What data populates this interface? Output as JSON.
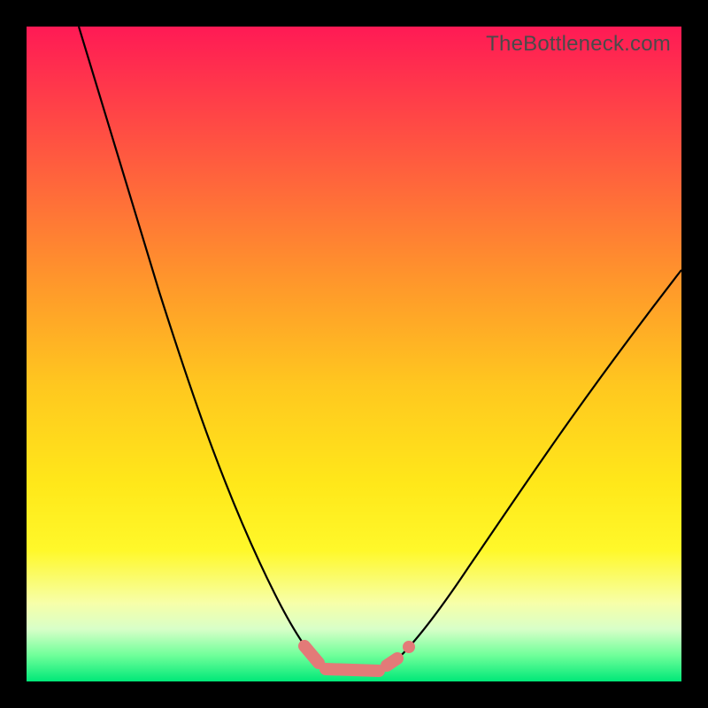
{
  "watermark": "TheBottleneck.com",
  "colors": {
    "frame": "#000000",
    "curve": "#000000",
    "marker": "#e37a78",
    "gradient_top": "#ff1a55",
    "gradient_bottom": "#00e878"
  },
  "chart_data": {
    "type": "line",
    "title": "",
    "xlabel": "",
    "ylabel": "",
    "xlim": [
      0,
      100
    ],
    "ylim": [
      0,
      100
    ],
    "note": "Axes unlabeled; values estimated from pixel positions on a 0–100 normalized grid. y=0 is bottom (green), y=100 is top (red). Curve resembles a bottleneck/deviation plot with minimum near x≈49.",
    "series": [
      {
        "name": "curve-left",
        "x": [
          8,
          12,
          16,
          20,
          24,
          28,
          32,
          36,
          40,
          43,
          45
        ],
        "y": [
          100,
          88,
          75,
          62,
          50,
          38,
          27,
          17,
          9,
          4,
          2
        ]
      },
      {
        "name": "curve-bottom",
        "x": [
          45,
          47,
          49,
          51,
          53,
          55
        ],
        "y": [
          2,
          1,
          1,
          1,
          1,
          2
        ]
      },
      {
        "name": "curve-right",
        "x": [
          55,
          58,
          62,
          67,
          73,
          80,
          88,
          96,
          100
        ],
        "y": [
          2,
          4,
          8,
          14,
          22,
          32,
          44,
          56,
          63
        ]
      }
    ],
    "markers": {
      "name": "highlight-segments",
      "description": "Salmon-colored rounded segments near the curve minimum",
      "segments": [
        {
          "x": [
            42.5,
            44.5
          ],
          "y": [
            5.5,
            2.8
          ]
        },
        {
          "x": [
            45.5,
            53.5
          ],
          "y": [
            1.6,
            1.4
          ]
        },
        {
          "x": [
            55.0,
            56.5
          ],
          "y": [
            2.2,
            3.2
          ]
        },
        {
          "x": [
            58.0,
            58.8
          ],
          "y": [
            4.8,
            5.6
          ]
        }
      ]
    }
  }
}
